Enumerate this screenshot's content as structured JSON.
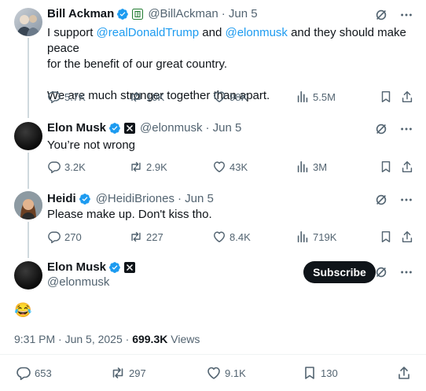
{
  "tweets": [
    {
      "name": "Bill Ackman",
      "handle": "@BillAckman",
      "date": "· Jun 5",
      "text_parts": [
        "I support ",
        "@realDonaldTrump",
        " and ",
        "@elonmusk",
        " and they should make peace",
        "for the benefit of our great country.",
        "We are much stronger together than apart."
      ],
      "stats": {
        "replies": "5.7K",
        "reposts": "10K",
        "likes": "98K",
        "views": "5.5M"
      }
    },
    {
      "name": "Elon Musk",
      "handle": "@elonmusk",
      "date": "· Jun 5",
      "text": "You’re not wrong",
      "stats": {
        "replies": "3.2K",
        "reposts": "2.9K",
        "likes": "43K",
        "views": "3M"
      }
    },
    {
      "name": "Heidi",
      "handle": "@HeidiBriones",
      "date": "· Jun 5",
      "text": "Please make up. Don't kiss tho.",
      "stats": {
        "replies": "270",
        "reposts": "227",
        "likes": "8.4K",
        "views": "719K"
      }
    }
  ],
  "main": {
    "name": "Elon Musk",
    "handle": "@elonmusk",
    "subscribe_label": "Subscribe",
    "text": "😂",
    "time": "9:31 PM · Jun 5, 2025 · ",
    "views_count": "699.3K",
    "views_label": " Views",
    "stats": {
      "replies": "653",
      "reposts": "297",
      "likes": "9.1K",
      "bookmarks": "130"
    }
  },
  "colors": {
    "accent": "#1d9bf0",
    "text": "#0f1419",
    "muted": "#536471",
    "verified": "#1d9bf0"
  }
}
